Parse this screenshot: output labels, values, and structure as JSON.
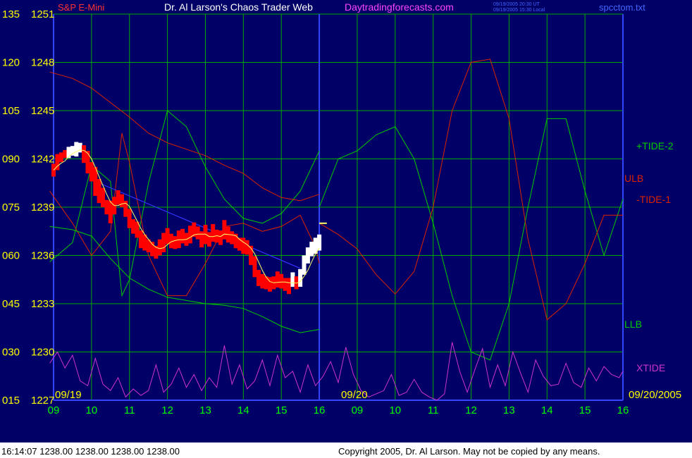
{
  "header": {
    "symbol": "S&P E-Mini",
    "title": "Dr. Al Larson's Chaos Trader Web",
    "site": "Daytradingforecasts.com",
    "timestamps": [
      "09/19/2005 20:30 UT",
      "09/19/2005 15:30 Local"
    ],
    "filename": "spcctom.txt"
  },
  "footer": {
    "status": "16:14:07  1238.00 1238.00 1238.00 1238.00",
    "copyright": "Copyright 2005, Dr. Al Larson. May not be copied by any means."
  },
  "colors": {
    "background": "#000066",
    "grid": "#00aa00",
    "axis_text": "#ffff00",
    "time_text": "#00ff00",
    "price_down": "#ff0000",
    "price_up": "#ffffff",
    "moving_avg": "#ffff66",
    "trend_line": "#3333ff",
    "tide_plus": "#00cc00",
    "tide_minus": "#dd2200",
    "xtide": "#cc33cc"
  },
  "chart_data": {
    "type": "line",
    "title": "Dr. Al Larson's Chaos Trader Web",
    "y_left_labels": [
      "135",
      "120",
      "105",
      "090",
      "075",
      "060",
      "045",
      "030",
      "015"
    ],
    "y_price_labels": [
      "1251",
      "1248",
      "1245",
      "1242",
      "1239",
      "1236",
      "1233",
      "1230",
      "1227"
    ],
    "y_price_range": [
      1227,
      1251
    ],
    "x_hour_labels": [
      "09",
      "10",
      "11",
      "12",
      "13",
      "14",
      "15",
      "16",
      "09",
      "10",
      "11",
      "12",
      "13",
      "14",
      "15",
      "16"
    ],
    "date_labels": [
      "09/19",
      "09/20",
      "09/20/2005"
    ],
    "grid": true,
    "series_labels": {
      "tide2": "+TIDE-2",
      "ulb": "ULB",
      "tide1": "-TIDE-1",
      "llb": "LLB",
      "xtide": "XTIDE"
    },
    "price_bars": {
      "x_hours": [
        9.0,
        9.1,
        9.2,
        9.3,
        9.4,
        9.5,
        9.6,
        9.7,
        9.8,
        9.9,
        10.0,
        10.1,
        10.2,
        10.3,
        10.4,
        10.5,
        10.6,
        10.7,
        10.8,
        10.9,
        11.0,
        11.1,
        11.2,
        11.3,
        11.4,
        11.5,
        11.6,
        11.7,
        11.8,
        11.9,
        12.0,
        12.1,
        12.2,
        12.3,
        12.4,
        12.5,
        12.6,
        12.7,
        12.8,
        12.9,
        13.0,
        13.1,
        13.2,
        13.3,
        13.4,
        13.5,
        13.6,
        13.7,
        13.8,
        13.9,
        14.0,
        14.1,
        14.2,
        14.3,
        14.4,
        14.5,
        14.6,
        14.7,
        14.8,
        14.9,
        15.0,
        15.1,
        15.2,
        15.3,
        15.4,
        15.5,
        15.6,
        15.7,
        15.8,
        15.9,
        16.0
      ],
      "close": [
        1241.3,
        1241.8,
        1242.1,
        1242.3,
        1242.4,
        1242.5,
        1242.6,
        1242.7,
        1242.3,
        1241.8,
        1241.2,
        1240.6,
        1240.0,
        1239.6,
        1239.0,
        1238.7,
        1239.1,
        1239.6,
        1239.4,
        1238.9,
        1238.3,
        1237.8,
        1237.6,
        1237.0,
        1236.8,
        1236.6,
        1236.4,
        1236.2,
        1236.5,
        1236.8,
        1237.2,
        1236.9,
        1236.8,
        1237.0,
        1237.2,
        1237.0,
        1237.3,
        1237.6,
        1237.4,
        1237.0,
        1237.3,
        1237.0,
        1237.4,
        1237.2,
        1237.1,
        1237.6,
        1237.3,
        1237.1,
        1236.9,
        1236.7,
        1236.6,
        1236.5,
        1236.0,
        1235.3,
        1234.6,
        1234.4,
        1234.3,
        1234.2,
        1234.3,
        1234.5,
        1234.4,
        1234.2,
        1234.1,
        1234.5,
        1234.3,
        1234.6,
        1235.4,
        1236.0,
        1236.4,
        1236.6,
        1236.8
      ],
      "range": [
        0.8,
        1.0,
        0.6,
        0.5,
        0.7,
        0.6,
        0.9,
        0.6,
        1.1,
        1.4,
        1.2,
        1.8,
        1.5,
        1.2,
        0.9,
        1.4,
        1.1,
        0.9,
        0.8,
        1.0,
        1.2,
        0.9,
        1.0,
        1.1,
        1.0,
        0.8,
        0.9,
        0.8,
        1.0,
        1.2,
        1.0,
        0.9,
        0.8,
        1.1,
        0.9,
        0.8,
        1.1,
        0.9,
        0.8,
        1.0,
        1.2,
        0.9,
        1.1,
        0.8,
        0.9,
        1.2,
        1.0,
        0.8,
        0.9,
        0.8,
        1.0,
        0.9,
        1.2,
        1.3,
        1.0,
        0.9,
        0.8,
        0.9,
        0.8,
        1.0,
        0.9,
        0.8,
        1.0,
        0.9,
        0.8,
        1.1,
        1.2,
        1.0,
        0.9,
        1.0,
        1.0
      ]
    },
    "last_price": 1238.0,
    "trend_line": {
      "x_hours": [
        10.1,
        15.5
      ],
      "y": [
        1240.6,
        1235.2
      ]
    },
    "forecast_lines": [
      {
        "key": "tide2",
        "x_hours": [
          8.9,
          9.5,
          10.0,
          10.5,
          10.8,
          11.0,
          11.5,
          12.0,
          12.5,
          13.0,
          13.5,
          14.0,
          14.5,
          15.0,
          15.5,
          16.0
        ],
        "y": [
          1235.6,
          1236.8,
          1241.6,
          1240.6,
          1233.5,
          1234.5,
          1240.5,
          1245.0,
          1244.0,
          1241.5,
          1239.5,
          1238.3,
          1238.0,
          1238.6,
          1240.0,
          1242.5
        ]
      },
      {
        "key": "tide2",
        "x_hours": [
          16.0,
          16.5,
          17.0,
          17.5,
          18.0,
          18.5,
          19.0,
          19.5,
          20.0,
          20.5,
          21.0,
          21.5,
          22.0,
          22.5,
          23.0,
          23.5,
          24.0
        ],
        "y": [
          1239.0,
          1242.0,
          1242.5,
          1243.5,
          1244.0,
          1242.0,
          1238.0,
          1233.5,
          1230.0,
          1229.5,
          1233.0,
          1239.0,
          1244.5,
          1244.5,
          1240.0,
          1236.0,
          1239.5
        ]
      },
      {
        "key": "ulb",
        "x_hours": [
          8.9,
          9.5,
          10.0,
          10.5,
          11.0,
          11.5,
          12.0,
          12.5,
          13.0,
          13.5,
          14.0,
          14.5,
          15.0,
          15.5,
          16.0
        ],
        "y": [
          1247.4,
          1247.0,
          1246.4,
          1245.5,
          1244.6,
          1243.6,
          1243.0,
          1242.6,
          1242.2,
          1241.6,
          1241.1,
          1240.2,
          1239.6,
          1239.4,
          1239.8
        ]
      },
      {
        "key": "tide1",
        "x_hours": [
          8.9,
          9.5,
          10.0,
          10.5,
          10.8,
          11.0,
          11.5,
          12.0,
          12.5,
          13.0,
          13.5,
          14.0,
          14.5,
          15.0,
          15.5,
          15.9,
          16.0
        ],
        "y": [
          1240.0,
          1238.0,
          1236.0,
          1237.5,
          1243.6,
          1241.8,
          1236.0,
          1233.5,
          1233.5,
          1235.5,
          1237.8,
          1238.0,
          1237.5,
          1237.8,
          1238.5,
          1236.5,
          1235.5
        ]
      },
      {
        "key": "tide1",
        "x_hours": [
          16.0,
          16.5,
          17.0,
          17.5,
          18.0,
          18.5,
          19.0,
          19.5,
          20.0,
          20.5,
          21.0,
          21.5,
          22.0,
          22.5,
          23.0,
          23.5,
          24.0
        ],
        "y": [
          1238.0,
          1237.3,
          1236.4,
          1234.8,
          1233.6,
          1235.0,
          1239.0,
          1245.0,
          1248.0,
          1248.2,
          1244.5,
          1237.0,
          1232.0,
          1233.0,
          1235.5,
          1238.5,
          1238.5
        ]
      },
      {
        "key": "llb",
        "x_hours": [
          8.9,
          9.5,
          10.0,
          10.5,
          11.0,
          11.5,
          12.0,
          12.5,
          13.0,
          13.5,
          14.0,
          14.5,
          15.0,
          15.5,
          16.0
        ],
        "y": [
          1237.8,
          1237.6,
          1237.2,
          1235.8,
          1234.6,
          1233.9,
          1233.4,
          1233.2,
          1233.0,
          1232.9,
          1232.7,
          1232.2,
          1231.6,
          1231.2,
          1231.4
        ]
      }
    ],
    "xtide": {
      "x_hours": [
        8.9,
        9.1,
        9.3,
        9.5,
        9.7,
        9.9,
        10.1,
        10.3,
        10.5,
        10.7,
        10.9,
        11.1,
        11.3,
        11.5,
        11.7,
        11.9,
        12.1,
        12.3,
        12.5,
        12.7,
        12.9,
        13.1,
        13.3,
        13.5,
        13.7,
        13.9,
        14.1,
        14.3,
        14.5,
        14.7,
        14.9,
        15.1,
        15.3,
        15.5,
        15.7,
        15.9,
        16.1,
        16.3,
        16.5,
        16.7,
        16.9,
        17.1,
        17.3,
        17.5,
        17.7,
        17.9,
        18.1,
        18.3,
        18.5,
        18.7,
        18.9,
        19.1,
        19.3,
        19.5,
        19.7,
        19.9,
        20.1,
        20.3,
        20.5,
        20.7,
        20.9,
        21.1,
        21.3,
        21.5,
        21.7,
        21.9,
        22.1,
        22.3,
        22.5,
        22.7,
        22.9,
        23.1,
        23.3,
        23.5,
        23.7,
        23.9,
        24.0
      ],
      "y": [
        1229.3,
        1230.0,
        1229.0,
        1229.8,
        1228.2,
        1227.9,
        1229.6,
        1228.0,
        1227.6,
        1228.4,
        1227.2,
        1227.7,
        1227.3,
        1227.6,
        1229.2,
        1227.5,
        1228.0,
        1229.0,
        1227.8,
        1228.6,
        1227.6,
        1228.4,
        1227.8,
        1230.4,
        1228.0,
        1229.2,
        1227.7,
        1228.2,
        1229.5,
        1227.9,
        1229.8,
        1228.4,
        1228.8,
        1227.5,
        1229.2,
        1227.9,
        1228.5,
        1229.4,
        1228.1,
        1230.3,
        1228.6,
        1227.6,
        1227.2,
        1227.4,
        1227.6,
        1228.6,
        1227.3,
        1227.5,
        1228.3,
        1227.5,
        1227.2,
        1227.0,
        1227.4,
        1230.6,
        1228.8,
        1227.5,
        1228.9,
        1230.2,
        1227.8,
        1229.2,
        1227.9,
        1230.0,
        1228.7,
        1227.5,
        1229.5,
        1228.5,
        1227.9,
        1228.0,
        1229.3,
        1228.1,
        1227.8,
        1229.0,
        1228.2,
        1229.1,
        1228.6,
        1228.4,
        1228.8
      ]
    }
  }
}
